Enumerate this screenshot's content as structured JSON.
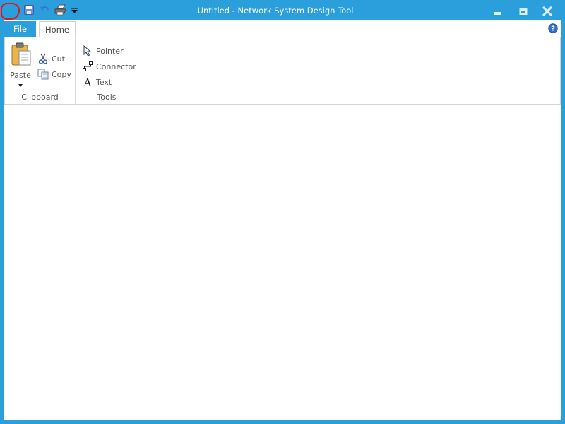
{
  "window": {
    "title": "Untitled - Network System Design Tool"
  },
  "quick_access": {
    "icons": [
      "app-icon",
      "save-icon",
      "undo-icon",
      "print-icon",
      "customize-dropdown-icon"
    ]
  },
  "ribbon": {
    "tabs": [
      {
        "label": "File",
        "active": false
      },
      {
        "label": "Home",
        "active": true
      }
    ],
    "groups": {
      "clipboard": {
        "label": "Clipboard",
        "paste_label": "Paste",
        "cut_label": "Cut",
        "copy_label": "Copy"
      },
      "tools": {
        "label": "Tools",
        "pointer_label": "Pointer",
        "connector_label": "Connector",
        "text_label": "Text"
      }
    }
  },
  "colors": {
    "accent": "#2a9fdb",
    "highlight_circle": "#e0161b",
    "panel_border": "#d3d3d3"
  }
}
